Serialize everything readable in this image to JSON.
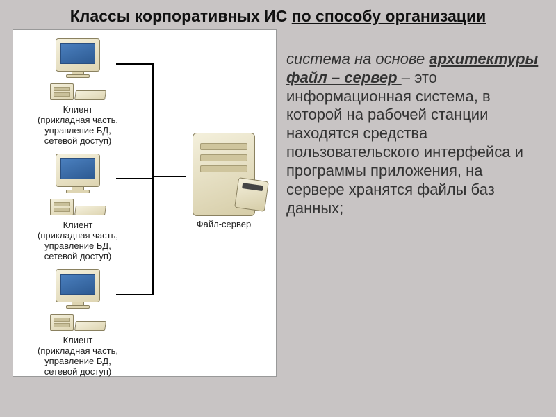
{
  "title": {
    "part1": "Классы корпоративных ИС ",
    "underlined": "по способу организации"
  },
  "diagram": {
    "client_label_line1": "Клиент",
    "client_label_line2": "(прикладная часть,",
    "client_label_line3": "управление БД,",
    "client_label_line4": "сетевой доступ)",
    "server_label": "Файл-сервер"
  },
  "description": {
    "intro": "система на основе ",
    "bold_underlined": "архитектуры файл – сервер ",
    "dash": "– ",
    "rest": "это информационная система, в которой на рабочей станции находятся средства пользовательского интерфейса и программы приложения, на сервере хранятся файлы баз данных;"
  }
}
